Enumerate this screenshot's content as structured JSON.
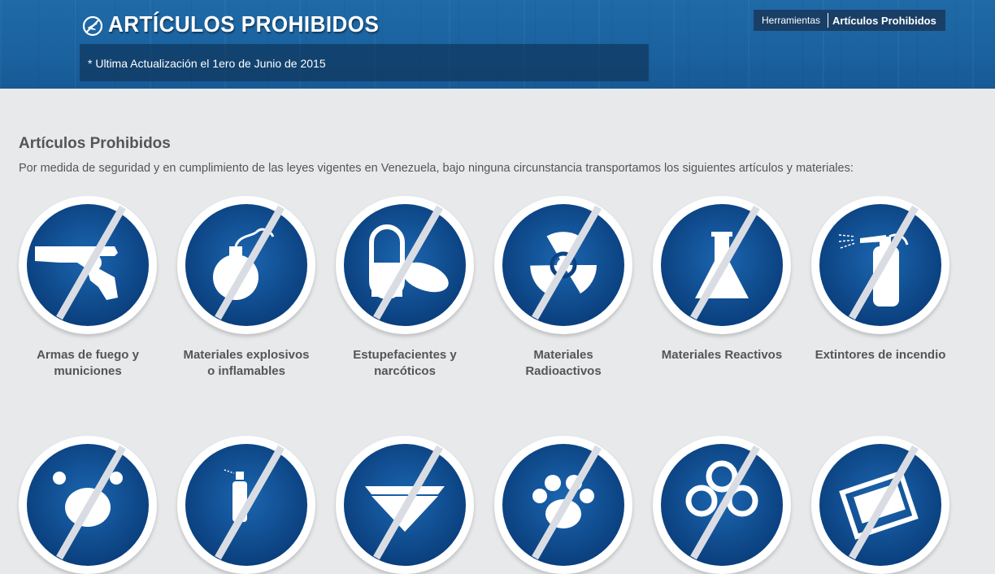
{
  "header": {
    "title": "ARTÍCULOS PROHIBIDOS",
    "title_icon": "prohibited-plane-icon",
    "update_note": "* Ultima Actualización el 1ero de Junio de 2015",
    "breadcrumb": [
      "Herramientas",
      "Artículos Prohibidos"
    ]
  },
  "main": {
    "section_title": "Artículos Prohibidos",
    "intro": "Por medida de seguridad y en cumplimiento de las leyes vigentes en Venezuela, bajo ninguna circunstancia transportamos los siguientes artículos y materiales:",
    "items": [
      {
        "line1": "Armas de fuego y",
        "line2": "municiones",
        "icon": "prohibited-gun-icon"
      },
      {
        "line1": "Materiales explosivos",
        "line2": "o inflamables",
        "icon": "prohibited-bomb-icon"
      },
      {
        "line1": "Estupefacientes y",
        "line2": "narcóticos",
        "icon": "prohibited-pills-icon"
      },
      {
        "line1": "Materiales",
        "line2": "Radioactivos",
        "icon": "prohibited-radioactive-icon"
      },
      {
        "line1": "Materiales Reactivos",
        "line2": "",
        "icon": "prohibited-flask-icon"
      },
      {
        "line1": "Extintores de incendio",
        "line2": "",
        "icon": "prohibited-extinguisher-icon"
      }
    ],
    "items_row2_icons": [
      "prohibited-poison-icon",
      "prohibited-spray-icon",
      "prohibited-diamond-icon",
      "prohibited-paw-icon",
      "prohibited-biohazard-icon",
      "prohibited-money-icon"
    ]
  },
  "colors": {
    "banner": "#1a62a0",
    "sign_blue": "#0c4a8e",
    "text": "#555555"
  }
}
